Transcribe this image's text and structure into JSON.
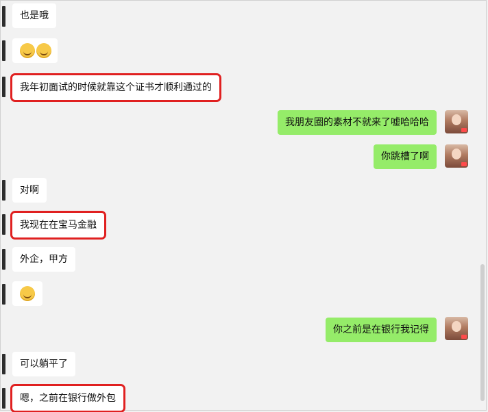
{
  "messages": [
    {
      "side": "left",
      "text": "也是哦",
      "highlighted": false
    },
    {
      "side": "left",
      "text": "",
      "emoji": [
        "grin-tears-emoji",
        "grin-tears-emoji"
      ],
      "highlighted": false
    },
    {
      "side": "left",
      "text": "我年初面试的时候就靠这个证书才顺利通过的",
      "highlighted": true
    },
    {
      "side": "right",
      "text": "我朋友圈的素材不就来了嘘哈哈哈",
      "highlighted": false
    },
    {
      "side": "right",
      "text": "你跳槽了啊",
      "highlighted": false
    },
    {
      "side": "left",
      "text": "对啊",
      "highlighted": false
    },
    {
      "side": "left",
      "text": "我现在在宝马金融",
      "highlighted": true
    },
    {
      "side": "left",
      "text": "外企，甲方",
      "highlighted": false
    },
    {
      "side": "left",
      "text": "",
      "emoji": [
        "hug-emoji"
      ],
      "highlighted": false
    },
    {
      "side": "right",
      "text": "你之前是在银行我记得",
      "highlighted": false
    },
    {
      "side": "left",
      "text": "可以躺平了",
      "highlighted": false
    },
    {
      "side": "left",
      "text": "嗯，之前在银行做外包",
      "highlighted": true
    }
  ],
  "colors": {
    "left_bubble": "#ffffff",
    "right_bubble": "#95ec69",
    "highlight": "#e02020",
    "background": "#f2f2f2"
  }
}
